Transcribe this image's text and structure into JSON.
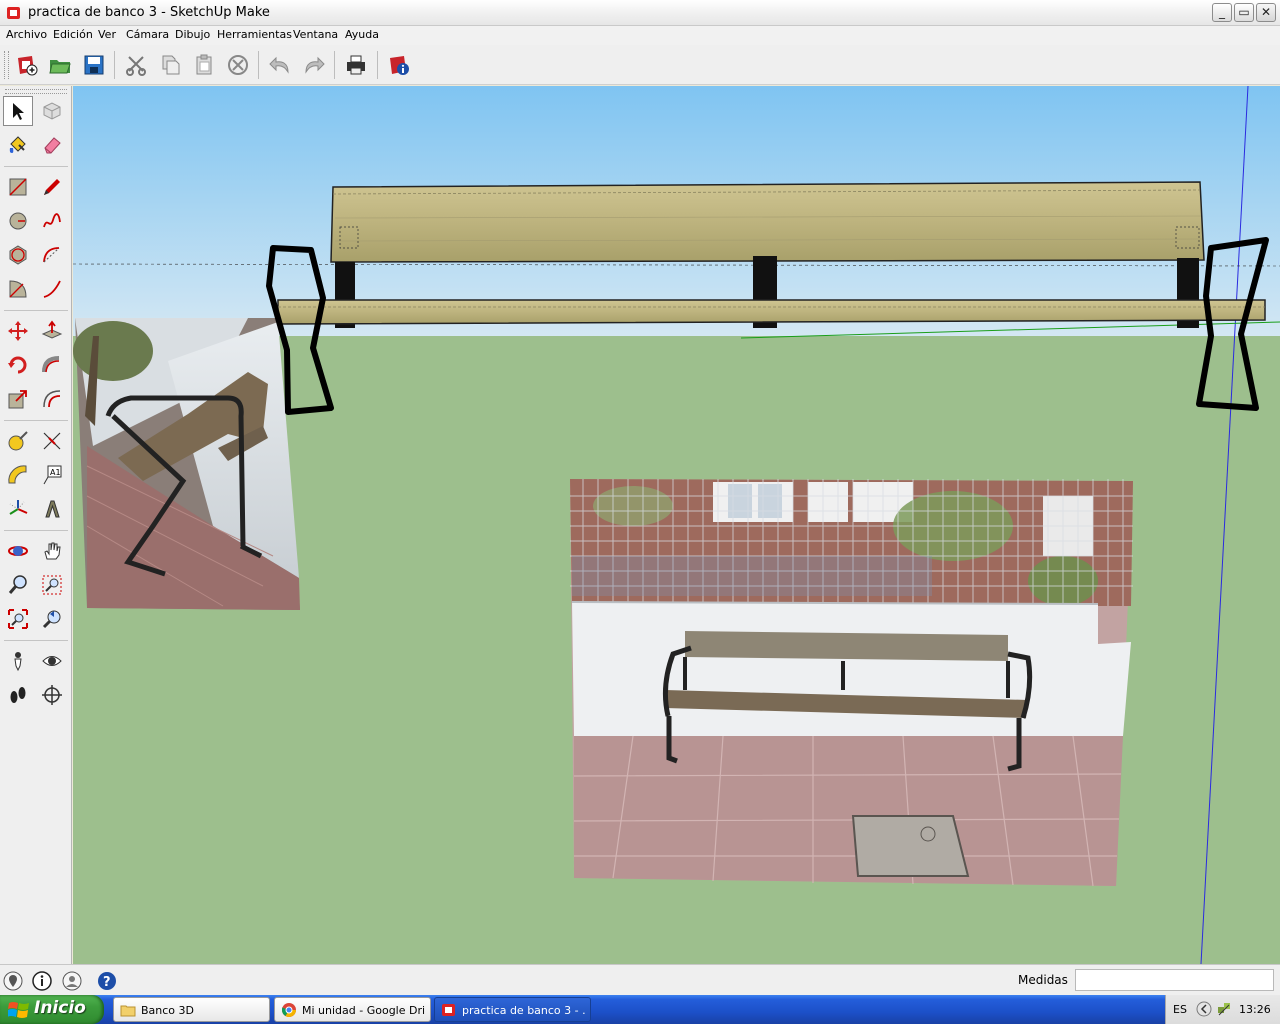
{
  "window": {
    "title": "practica de banco 3 - SketchUp Make",
    "app_icon": "sketchup-icon"
  },
  "menubar": {
    "items": [
      "Archivo",
      "Edición",
      "Ver",
      "Cámara",
      "Dibujo",
      "Herramientas",
      "Ventana",
      "Ayuda"
    ]
  },
  "toolbar": {
    "buttons": [
      "new-model-icon",
      "open-folder-icon",
      "save-icon",
      "cut-icon",
      "copy-icon",
      "paste-icon",
      "erase-icon",
      "undo-icon",
      "redo-icon",
      "print-icon",
      "model-info-icon"
    ]
  },
  "tools": [
    "select-icon",
    "make-component-icon",
    "paint-bucket-icon",
    "eraser-icon",
    "rectangle-icon",
    "pencil-icon",
    "circle-icon",
    "freehand-icon",
    "polygon-icon",
    "arc-icon",
    "pie-icon",
    "two-point-arc-icon",
    "move-icon",
    "push-pull-icon",
    "rotate-icon",
    "follow-me-icon",
    "scale-icon",
    "offset-icon",
    "tape-measure-icon",
    "dimension-icon",
    "protractor-icon",
    "text-icon",
    "axes-icon",
    "3d-text-icon",
    "orbit-icon",
    "pan-icon",
    "zoom-icon",
    "zoom-window-icon",
    "zoom-extents-icon",
    "previous-view-icon",
    "position-camera-icon",
    "look-around-icon",
    "walk-icon",
    "section-plane-icon"
  ],
  "colors": {
    "sky_top": "#7fc4f2",
    "sky_bottom": "#d5e8f3",
    "ground": "#9dbf8d",
    "wood": "#bdb37e",
    "taskbar": "#245edb"
  },
  "statusbar": {
    "measure_label": "Medidas",
    "measure_value": ""
  },
  "taskbar": {
    "start_label": "Inicio",
    "tasks": [
      {
        "label": "Banco 3D",
        "icon": "folder-icon"
      },
      {
        "label": "Mi unidad - Google Dri...",
        "icon": "chrome-icon"
      },
      {
        "label": "practica de banco 3 - ...",
        "icon": "sketchup-icon"
      }
    ],
    "tray": {
      "language": "ES",
      "clock": "13:26"
    }
  }
}
